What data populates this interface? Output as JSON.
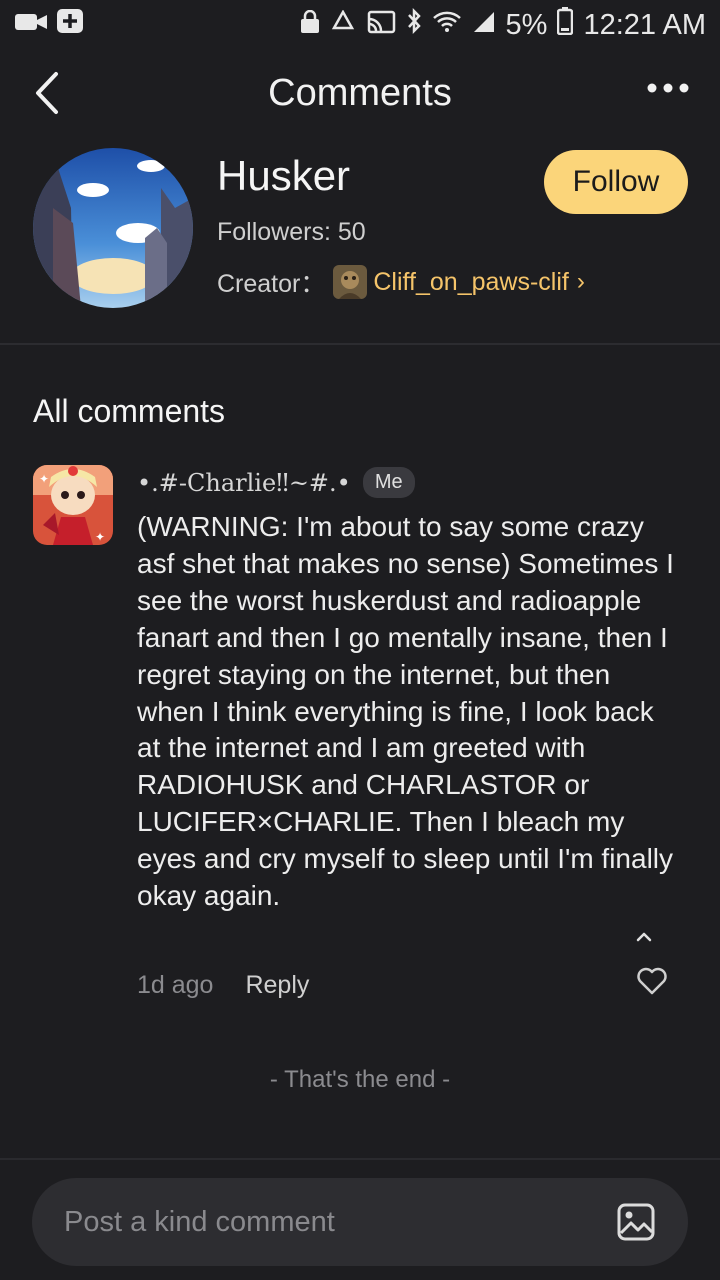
{
  "status_bar": {
    "battery": "5%",
    "time": "12:21 AM",
    "icons": [
      "video-camera-icon",
      "plus-icon",
      "lock-icon",
      "recycle-icon",
      "cast-icon",
      "bluetooth-icon",
      "wifi-icon",
      "signal-icon",
      "battery-icon"
    ]
  },
  "header": {
    "title": "Comments",
    "back_icon": "chevron-left-icon",
    "more_icon": "more-dots-icon"
  },
  "profile": {
    "name": "Husker",
    "followers": "Followers: 50",
    "creator_label": "Creator：",
    "creator_name": "Cliff_on_paws-clif",
    "creator_chevron": "›",
    "follow_label": "Follow"
  },
  "comments_section": {
    "title": "All comments",
    "comments": [
      {
        "author": "•.#-Charlie‼~#.•",
        "badge": "Me",
        "text": "(WARNING: I'm about to say some crazy asf shet that makes no sense) Sometimes I see the worst huskerdust and radioapple fanart and then I go mentally insane, then I regret staying on the internet, but then when I think everything is fine, I look back at the internet and I am greeted with RADIOHUSK and CHARLASTOR or LUCIFER×CHARLIE. Then I bleach my eyes and cry myself to sleep until I'm finally okay again.",
        "time": "1d ago",
        "reply_label": "Reply"
      }
    ],
    "end_text": "- That's the end -"
  },
  "composer": {
    "placeholder": "Post a kind comment",
    "image_icon": "image-icon"
  },
  "colors": {
    "background": "#1d1d20",
    "accent": "#fbd57a",
    "creator_link": "#f5c46a"
  }
}
